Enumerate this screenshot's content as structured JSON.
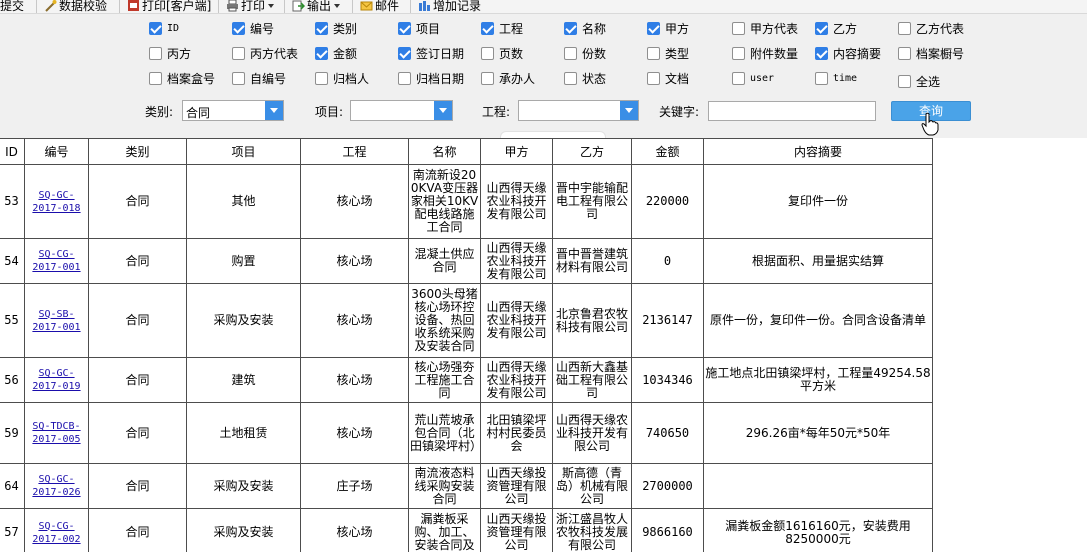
{
  "toolbar": {
    "submit": "提交",
    "validate": "数据校验",
    "print_client": "打印[客户端]",
    "print": "打印",
    "export": "输出",
    "mail": "邮件",
    "add_record": "增加记录"
  },
  "checkboxes": [
    {
      "label": "ID",
      "checked": true
    },
    {
      "label": "编号",
      "checked": true
    },
    {
      "label": "类别",
      "checked": true
    },
    {
      "label": "项目",
      "checked": true
    },
    {
      "label": "工程",
      "checked": true
    },
    {
      "label": "名称",
      "checked": true
    },
    {
      "label": "甲方",
      "checked": true
    },
    {
      "label": "甲方代表",
      "checked": false
    },
    {
      "label": "乙方",
      "checked": true
    },
    {
      "label": "乙方代表",
      "checked": false
    },
    {
      "label": "丙方",
      "checked": false
    },
    {
      "label": "丙方代表",
      "checked": false
    },
    {
      "label": "金额",
      "checked": true
    },
    {
      "label": "签订日期",
      "checked": true
    },
    {
      "label": "页数",
      "checked": false
    },
    {
      "label": "份数",
      "checked": false
    },
    {
      "label": "类型",
      "checked": false
    },
    {
      "label": "附件数量",
      "checked": false
    },
    {
      "label": "内容摘要",
      "checked": true
    },
    {
      "label": "档案橱号",
      "checked": false
    },
    {
      "label": "档案盒号",
      "checked": false
    },
    {
      "label": "自编号",
      "checked": false
    },
    {
      "label": "归档人",
      "checked": false
    },
    {
      "label": "归档日期",
      "checked": false
    },
    {
      "label": "承办人",
      "checked": false
    },
    {
      "label": "状态",
      "checked": false
    },
    {
      "label": "文档",
      "checked": false
    },
    {
      "label": "user",
      "checked": false
    },
    {
      "label": "time",
      "checked": false
    },
    {
      "label": "全选",
      "checked": false
    }
  ],
  "filters": {
    "category_label": "类别:",
    "category_value": "合同",
    "project_label": "项目:",
    "project_value": "",
    "engineering_label": "工程:",
    "engineering_value": "",
    "keyword_label": "关键字:",
    "keyword_value": "",
    "query_button": "查询"
  },
  "table": {
    "headers": [
      "ID",
      "编号",
      "类别",
      "项目",
      "工程",
      "名称",
      "甲方",
      "乙方",
      "金额",
      "内容摘要"
    ],
    "rows": [
      {
        "id": "53",
        "code": "SQ-GC-2017-018",
        "category": "合同",
        "project": "其他",
        "engineering": "核心场",
        "name": "南流新设200KVA变压器家相关10KV配电线路施工合同",
        "party_a": "山西得天缘农业科技开发有限公司",
        "party_b": "晋中宇能输配电工程有限公司",
        "amount": "220000",
        "summary": "复印件一份"
      },
      {
        "id": "54",
        "code": "SQ-CG-2017-001",
        "category": "合同",
        "project": "购置",
        "engineering": "核心场",
        "name": "混凝土供应合同",
        "party_a": "山西得天缘农业科技开发有限公司",
        "party_b": "晋中晋誉建筑材料有限公司",
        "amount": "0",
        "summary": "根据面积、用量据实结算"
      },
      {
        "id": "55",
        "code": "SQ-SB-2017-001",
        "category": "合同",
        "project": "采购及安装",
        "engineering": "核心场",
        "name": "3600头母猪核心场环控设备、热回收系统采购及安装合同",
        "party_a": "山西得天缘农业科技开发有限公司",
        "party_b": "北京鲁君农牧科技有限公司",
        "amount": "2136147",
        "summary": "原件一份，复印件一份。合同含设备清单"
      },
      {
        "id": "56",
        "code": "SQ-GC-2017-019",
        "category": "合同",
        "project": "建筑",
        "engineering": "核心场",
        "name": "核心场强夯工程施工合同",
        "party_a": "山西得天缘农业科技开发有限公司",
        "party_b": "山西新大鑫基础工程有限公司",
        "amount": "1034346",
        "summary": "施工地点北田镇梁坪村，工程量49254.58平方米"
      },
      {
        "id": "59",
        "code": "SQ-TDCB-2017-005",
        "category": "合同",
        "project": "土地租赁",
        "engineering": "核心场",
        "name": "荒山荒坡承包合同（北田镇梁坪村）",
        "party_a": "北田镇梁坪村村民委员会",
        "party_b": "山西得天缘农业科技开发有限公司",
        "amount": "740650",
        "summary": "296.26亩*每年50元*50年"
      },
      {
        "id": "64",
        "code": "SQ-GC-2017-026",
        "category": "合同",
        "project": "采购及安装",
        "engineering": "庄子场",
        "name": "南流液态料线采购安装合同",
        "party_a": "山西天缘投资管理有限公司",
        "party_b": "斯高德（青岛）机械有限公司",
        "amount": "2700000",
        "summary": ""
      },
      {
        "id": "57",
        "code": "SQ-CG-2017-002",
        "category": "合同",
        "project": "采购及安装",
        "engineering": "核心场",
        "name": "漏粪板采购、加工、安装合同及",
        "party_a": "山西天缘投资管理有限公司",
        "party_b": "浙江盛昌牧人农牧科技发展有限公司",
        "amount": "9866160",
        "summary": "漏粪板金额1616160元，安装费用8250000元"
      }
    ]
  }
}
